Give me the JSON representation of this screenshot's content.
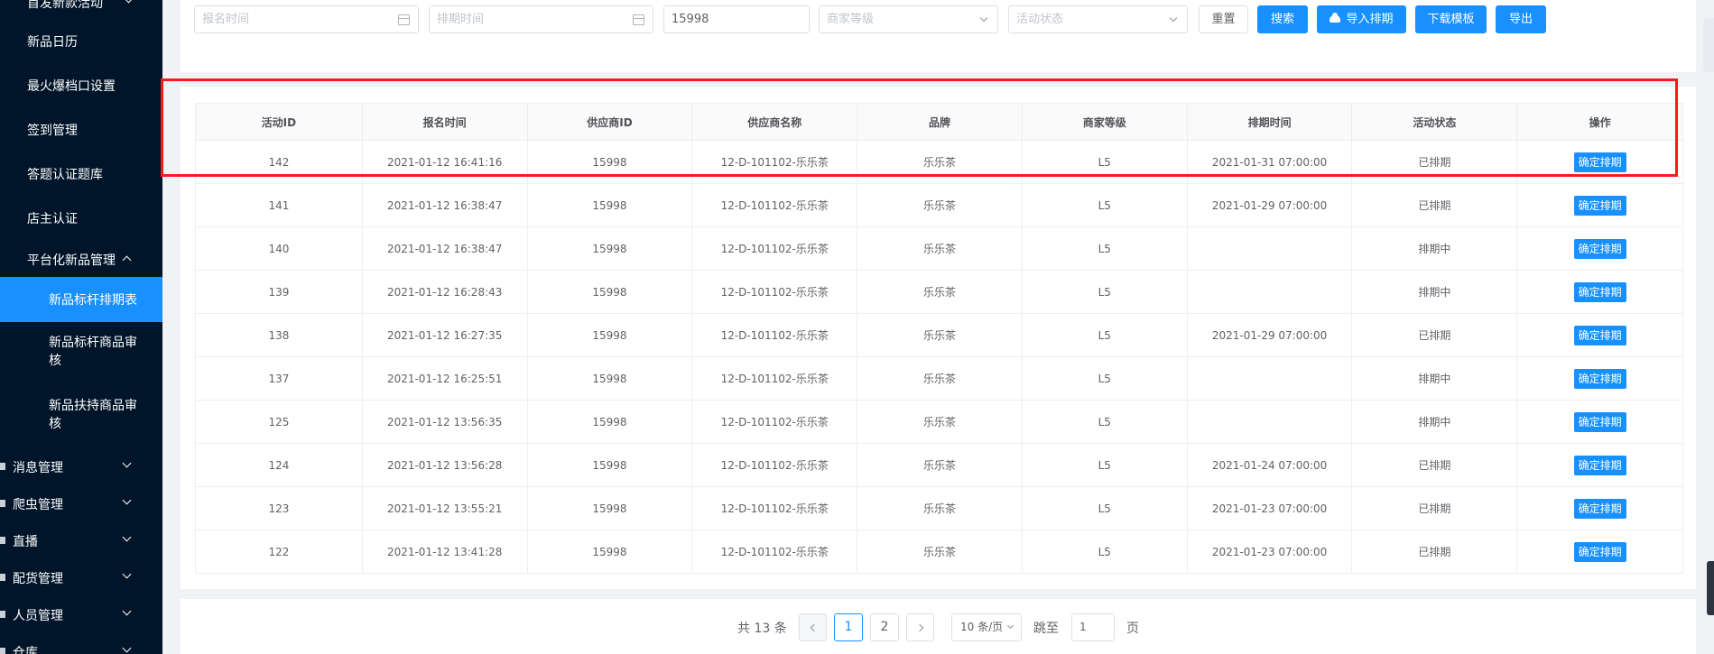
{
  "sidebar": {
    "top_partial": "首发新款活动",
    "items": [
      {
        "label": "新品日历"
      },
      {
        "label": "最火爆档口设置"
      },
      {
        "label": "签到管理"
      },
      {
        "label": "答题认证题库"
      },
      {
        "label": "店主认证"
      }
    ],
    "section": {
      "label": "平台化新品管理"
    },
    "active_item": {
      "label": "新品标杆排期表"
    },
    "sub_items": [
      {
        "label": "新品标杆商品审核"
      },
      {
        "label": "新品扶持商品审核"
      }
    ],
    "groups": [
      {
        "label": "消息管理"
      },
      {
        "label": "爬虫管理"
      },
      {
        "label": "直播"
      },
      {
        "label": "配货管理"
      },
      {
        "label": "人员管理"
      },
      {
        "label": "仓库"
      }
    ]
  },
  "filters": {
    "signup_time_placeholder": "报名时间",
    "schedule_time_placeholder": "排期时间",
    "supplier_id_value": "15998",
    "merchant_level_placeholder": "商家等级",
    "activity_status_placeholder": "活动状态",
    "reset_label": "重置",
    "search_label": "搜索",
    "import_label": "导入排期",
    "download_template_label": "下载模板",
    "export_label": "导出"
  },
  "table": {
    "headers": [
      "活动ID",
      "报名时间",
      "供应商ID",
      "供应商名称",
      "品牌",
      "商家等级",
      "排期时间",
      "活动状态",
      "操作"
    ],
    "op_label": "确定排期",
    "rows": [
      {
        "id": "142",
        "signup": "2021-01-12 16:41:16",
        "supplier_id": "15998",
        "supplier_name": "12-D-101102-乐乐茶",
        "brand": "乐乐茶",
        "level": "L5",
        "schedule": "2021-01-31 07:00:00",
        "status": "已排期"
      },
      {
        "id": "141",
        "signup": "2021-01-12 16:38:47",
        "supplier_id": "15998",
        "supplier_name": "12-D-101102-乐乐茶",
        "brand": "乐乐茶",
        "level": "L5",
        "schedule": "2021-01-29 07:00:00",
        "status": "已排期"
      },
      {
        "id": "140",
        "signup": "2021-01-12 16:38:47",
        "supplier_id": "15998",
        "supplier_name": "12-D-101102-乐乐茶",
        "brand": "乐乐茶",
        "level": "L5",
        "schedule": "",
        "status": "排期中"
      },
      {
        "id": "139",
        "signup": "2021-01-12 16:28:43",
        "supplier_id": "15998",
        "supplier_name": "12-D-101102-乐乐茶",
        "brand": "乐乐茶",
        "level": "L5",
        "schedule": "",
        "status": "排期中"
      },
      {
        "id": "138",
        "signup": "2021-01-12 16:27:35",
        "supplier_id": "15998",
        "supplier_name": "12-D-101102-乐乐茶",
        "brand": "乐乐茶",
        "level": "L5",
        "schedule": "2021-01-29 07:00:00",
        "status": "已排期"
      },
      {
        "id": "137",
        "signup": "2021-01-12 16:25:51",
        "supplier_id": "15998",
        "supplier_name": "12-D-101102-乐乐茶",
        "brand": "乐乐茶",
        "level": "L5",
        "schedule": "",
        "status": "排期中"
      },
      {
        "id": "125",
        "signup": "2021-01-12 13:56:35",
        "supplier_id": "15998",
        "supplier_name": "12-D-101102-乐乐茶",
        "brand": "乐乐茶",
        "level": "L5",
        "schedule": "",
        "status": "排期中"
      },
      {
        "id": "124",
        "signup": "2021-01-12 13:56:28",
        "supplier_id": "15998",
        "supplier_name": "12-D-101102-乐乐茶",
        "brand": "乐乐茶",
        "level": "L5",
        "schedule": "2021-01-24 07:00:00",
        "status": "已排期"
      },
      {
        "id": "123",
        "signup": "2021-01-12 13:55:21",
        "supplier_id": "15998",
        "supplier_name": "12-D-101102-乐乐茶",
        "brand": "乐乐茶",
        "level": "L5",
        "schedule": "2021-01-23 07:00:00",
        "status": "已排期"
      },
      {
        "id": "122",
        "signup": "2021-01-12 13:41:28",
        "supplier_id": "15998",
        "supplier_name": "12-D-101102-乐乐茶",
        "brand": "乐乐茶",
        "level": "L5",
        "schedule": "2021-01-23 07:00:00",
        "status": "已排期"
      }
    ]
  },
  "pagination": {
    "total_text": "共 13 条",
    "pages": [
      "1",
      "2"
    ],
    "current_page": "1",
    "page_size": "10 条/页",
    "goto_label": "跳至",
    "goto_value": "1",
    "page_suffix": "页"
  },
  "colors": {
    "primary": "#1890ff",
    "sidebar_bg": "#001529",
    "highlight": "#ff1a1a"
  }
}
